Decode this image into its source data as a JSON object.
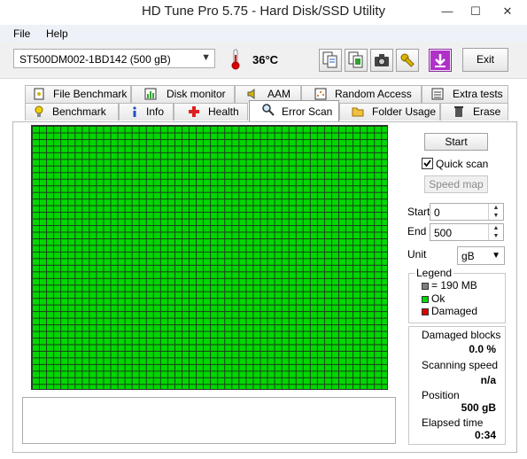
{
  "window": {
    "title": "HD Tune Pro 5.75 - Hard Disk/SSD Utility",
    "minimize": "—",
    "maximize": "☐",
    "close": "✕"
  },
  "menu": {
    "file": "File",
    "help": "Help"
  },
  "toolbar": {
    "drive": "ST500DM002-1BD142 (500 gB)",
    "temperature": "36°C",
    "exit": "Exit",
    "icons": [
      "thermometer-icon",
      "copy-text-icon",
      "copy-info-icon",
      "screenshot-camera-icon",
      "options-wrench-icon",
      "save-download-icon"
    ]
  },
  "tabs": {
    "row1": [
      "File Benchmark",
      "Disk monitor",
      "AAM",
      "Random Access",
      "Extra tests"
    ],
    "row2": [
      "Benchmark",
      "Info",
      "Health",
      "Error Scan",
      "Folder Usage",
      "Erase"
    ],
    "active": "Error Scan"
  },
  "scan": {
    "start_button": "Start",
    "quick_scan_label": "Quick scan",
    "quick_scan_checked": true,
    "speed_map_button": "Speed map",
    "start_label": "Start",
    "start_value": "0",
    "end_label": "End",
    "end_value": "500",
    "unit_label": "Unit",
    "unit_value": "gB"
  },
  "legend": {
    "title": "Legend",
    "block_size": "= 190 MB",
    "ok": "Ok",
    "damaged": "Damaged",
    "ok_color": "#00d800",
    "damaged_color": "#e00000",
    "block_color": "#808080"
  },
  "stats": {
    "damaged_blocks_label": "Damaged blocks",
    "damaged_blocks_value": "0.0 %",
    "scanning_speed_label": "Scanning speed",
    "scanning_speed_value": "n/a",
    "position_label": "Position",
    "position_value": "500 gB",
    "elapsed_label": "Elapsed time",
    "elapsed_value": "0:34"
  },
  "colors": {
    "block_ok": "#00d800",
    "accent": "#3399ff"
  }
}
